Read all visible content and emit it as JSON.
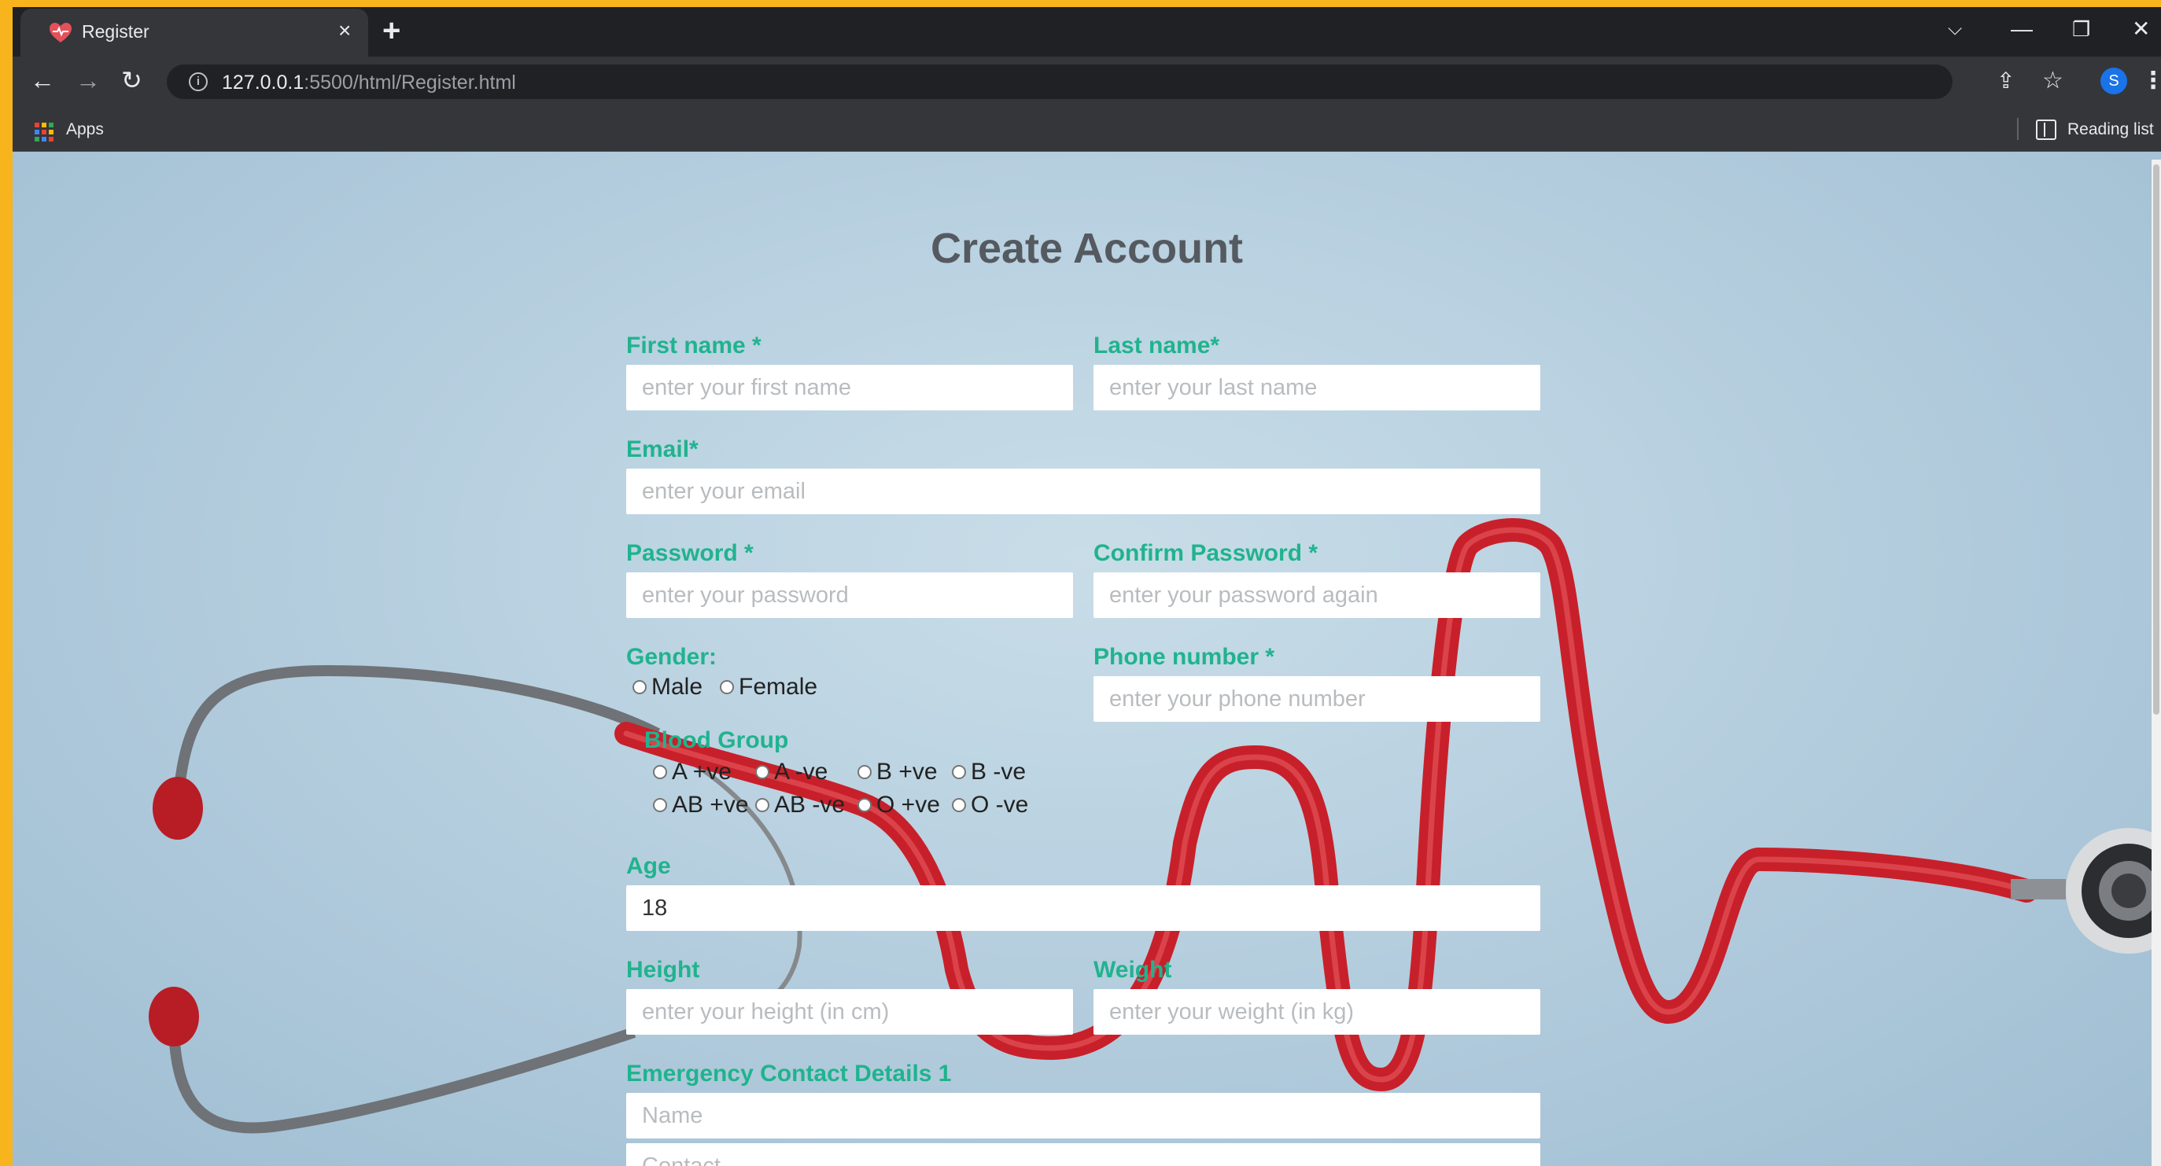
{
  "browser": {
    "tab_title": "Register",
    "tab_close": "×",
    "new_tab": "+",
    "url_host": "127.0.0.1",
    "url_path": ":5500/html/Register.html",
    "profile_initial": "S",
    "bookmarks": {
      "apps_label": "Apps",
      "reading_list_label": "Reading list"
    }
  },
  "page": {
    "title": "Create Account",
    "form": {
      "first_name": {
        "label": "First name *",
        "placeholder": "enter your first name"
      },
      "last_name": {
        "label": "Last name*",
        "placeholder": "enter your last name"
      },
      "email": {
        "label": "Email*",
        "placeholder": "enter your email"
      },
      "password": {
        "label": "Password *",
        "placeholder": "enter your password"
      },
      "confirm_password": {
        "label": "Confirm Password *",
        "placeholder": "enter your password again"
      },
      "gender": {
        "label": "Gender:",
        "options": [
          "Male",
          "Female"
        ]
      },
      "phone": {
        "label": "Phone number *",
        "placeholder": "enter your phone number"
      },
      "blood_group": {
        "label": "Blood Group",
        "options": [
          "A +ve",
          "A -ve",
          "B +ve",
          "B -ve",
          "AB +ve",
          "AB -ve",
          "O +ve",
          "O -ve"
        ]
      },
      "age": {
        "label": "Age",
        "value": "18"
      },
      "height": {
        "label": "Height",
        "placeholder": "enter your height (in cm)"
      },
      "weight": {
        "label": "Weight",
        "placeholder": "enter your weight (in kg)"
      },
      "emergency": {
        "label": "Emergency Contact Details 1",
        "name_placeholder": "Name",
        "contact_placeholder": "Contact"
      }
    }
  },
  "colors": {
    "label_green": "#20b38e",
    "title_gray": "#555a60",
    "stethoscope_red": "#c8202a",
    "frame_yellow": "#f8b41c"
  }
}
